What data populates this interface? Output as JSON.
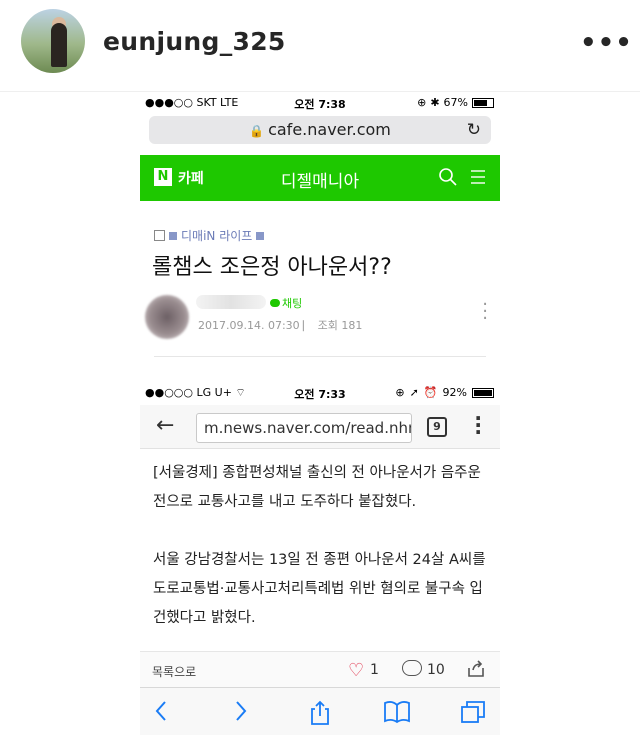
{
  "post": {
    "username": "eunjung_325",
    "more": "•••"
  },
  "screenshot1": {
    "status": {
      "carrier": "●●●○○ SKT  LTE",
      "time": "오전 7:38",
      "battery": "67%"
    },
    "url": "cafe.naver.com",
    "cafe": {
      "logo": "N",
      "label": "카페",
      "title": "디젤매니아"
    },
    "breadcrumb": "디매iN 라이프",
    "post_title": "롤챔스 조은정 아나운서??",
    "chat_label": "채팅",
    "meta": "2017.09.14. 07:30  ⎸ 조회 181"
  },
  "screenshot2": {
    "status": {
      "carrier": "●●○○○ LG U+",
      "time": "오전 7:33",
      "battery": "92%"
    },
    "url_main": "m.news.naver.com/read.nhn",
    "url_fade": "?",
    "tabs_count": "9",
    "article": [
      "[서울경제] 종합편성채널 출신의 전 아나운서가 음주운전으로 교통사고를 내고 도주하다 붙잡혔다.",
      "서울 강남경찰서는 13일 전 종편 아나운서 24살 A씨를 도로교통법·교통사고처리특례법 위반 혐의로 불구속 입건했다고 밝혔다."
    ],
    "footer": {
      "list_label": "목록으로",
      "likes": "1",
      "comments": "10"
    }
  },
  "colors": {
    "naver_green": "#1ec800",
    "like_red": "#e0364f",
    "link_blue": "#1a7cf5"
  },
  "icons": [
    "avatar",
    "more-icon",
    "lock-icon",
    "reload-icon",
    "search-icon",
    "menu-icon",
    "back-icon",
    "tabs-icon",
    "kebab-icon",
    "heart-icon",
    "comment-icon",
    "share-icon",
    "forward-icon",
    "bookmarks-icon"
  ]
}
